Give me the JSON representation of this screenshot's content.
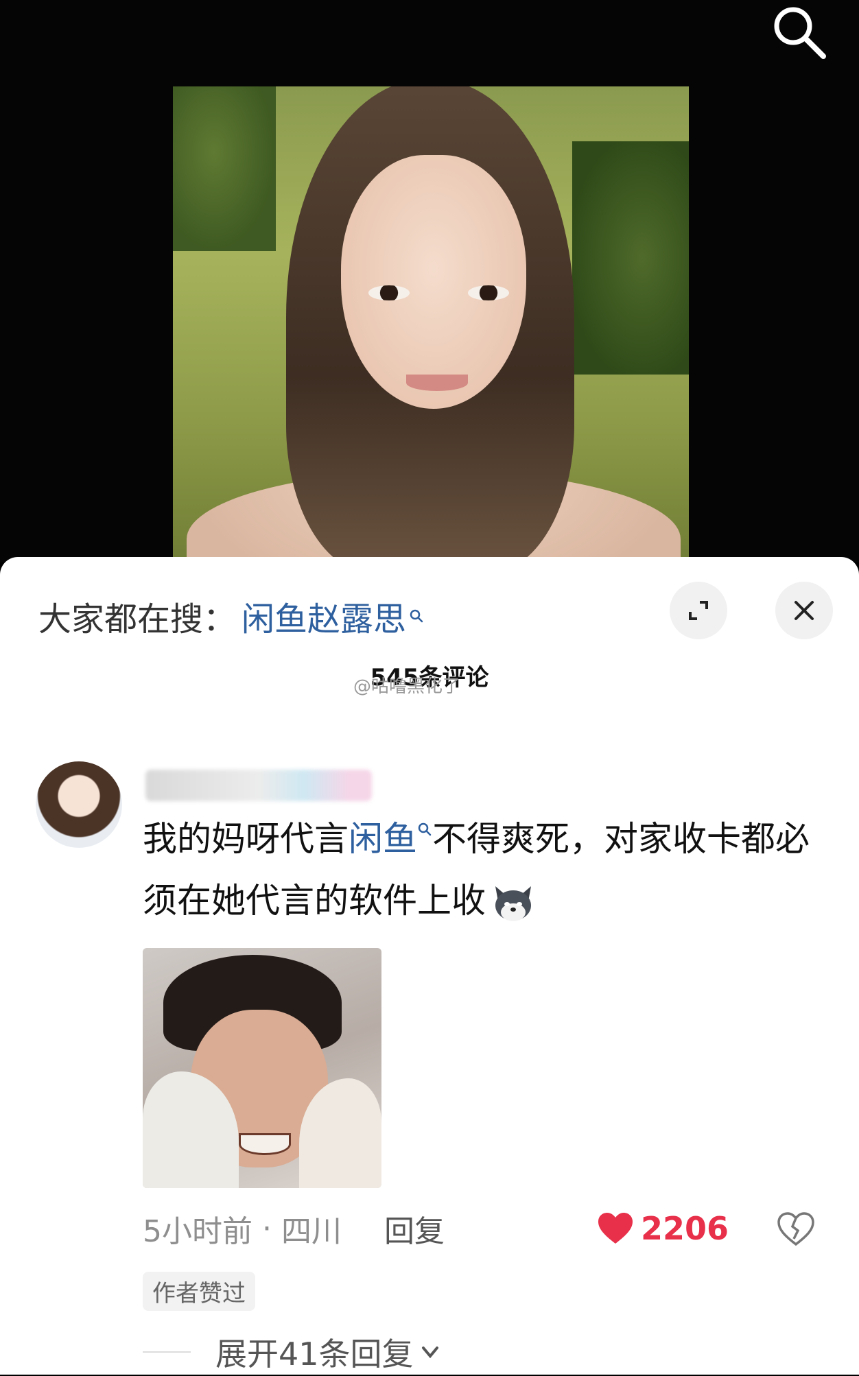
{
  "header": {
    "icon": "search-icon"
  },
  "sheet": {
    "trend_label": "大家都在搜：",
    "trend_link": "闲鱼赵露思",
    "comment_count": "545条评论",
    "watermark": "@咕噜黑化了"
  },
  "comment": {
    "text_part1": "我的妈呀代言",
    "text_link": "闲鱼",
    "text_part2": "不得爽死，对家收卡都必须在她代言的软件上收",
    "time": "5小时前",
    "separator": "·",
    "location": "四川",
    "reply_label": "回复",
    "like_count": "2206",
    "author_badge": "作者赞过",
    "expand_label": "展开41条回复"
  },
  "colors": {
    "link": "#2e5f9e",
    "like": "#e8304a"
  }
}
